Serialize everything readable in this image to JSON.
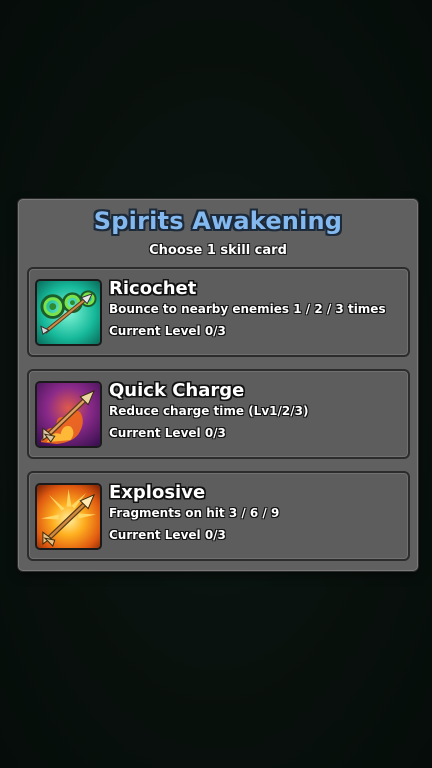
{
  "dialog": {
    "title": "Spirits Awakening",
    "subtitle": "Choose 1 skill card",
    "title_color": "#84b9ef"
  },
  "cards": [
    {
      "name": "Ricochet",
      "description": "Bounce to nearby enemies 1 / 2 / 3 times",
      "level": "Current Level 0/3",
      "icon": "ricochet-arrow-icon",
      "icon_color": "#19c4a8"
    },
    {
      "name": "Quick Charge",
      "description": "Reduce charge time (Lv1/2/3)",
      "level": "Current Level 0/3",
      "icon": "quick-charge-arrow-icon",
      "icon_color": "#7a2aa0"
    },
    {
      "name": "Explosive",
      "description": "Fragments on hit 3 / 6 / 9",
      "level": "Current Level 0/3",
      "icon": "explosive-arrow-icon",
      "icon_color": "#f08a10"
    }
  ]
}
